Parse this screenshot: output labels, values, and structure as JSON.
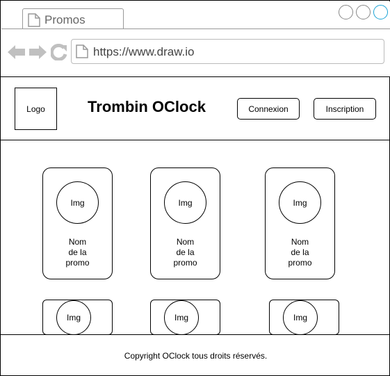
{
  "browser": {
    "tab_title": "Promos",
    "url": "https://www.draw.io"
  },
  "header": {
    "logo": "Logo",
    "title": "Trombin OClock",
    "login_label": "Connexion",
    "signup_label": "Inscription"
  },
  "promos": [
    {
      "img": "Img",
      "name": "Nom\nde la\npromo"
    },
    {
      "img": "Img",
      "name": "Nom\nde la\npromo"
    },
    {
      "img": "Img",
      "name": "Nom\nde la\npromo"
    },
    {
      "img": "Img"
    },
    {
      "img": "Img"
    },
    {
      "img": "Img"
    }
  ],
  "footer": {
    "copyright": "Copyright OClock tous droits réservés."
  },
  "colors": {
    "close_button": "#1aa3d6",
    "chrome_icon": "#c0c0c0"
  }
}
